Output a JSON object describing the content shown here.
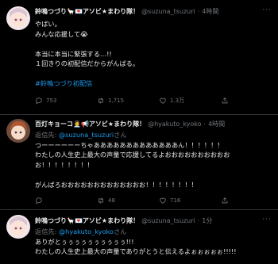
{
  "colors": {
    "background": "#000000",
    "text": "#e7e9ea",
    "muted": "#71767b",
    "link": "#1d9bf0",
    "divider": "#2f3336"
  },
  "tweets": [
    {
      "name": "鈴鳴つづり🦙💌アソビ★まわり隊！",
      "handle": "@suzuna_tsuzuri",
      "dot": "·",
      "time": "4時間",
      "lines": [
        "やばい。",
        "みんな応援して😭",
        "",
        "本当に本当に緊張する…!!",
        "１回きりの初配信だからがんばる。",
        ""
      ],
      "hashtag": "#鈴鳴つづり初配信",
      "stats": {
        "replies": "753",
        "retweets": "1,715",
        "likes": "1.3万"
      }
    },
    {
      "name": "百灯キョーコ👩‍💼📢アソビ★まわり隊！",
      "handle": "@hyakuto_kyoko",
      "dot": "·",
      "time": "4時間",
      "reply_prefix": "返信先: ",
      "reply_mention": "@suzuna_tsuzuri",
      "reply_suffix": "さん",
      "lines": [
        "つーーーーーーちゃあああああああああああああん！！！！！！",
        "わたしの人生史上最大の声量で応援してるよおおおおおおおおおお",
        "お！！！！！！！！",
        "",
        "がんばろおおおおおおおおおおおおお！！！！！！！！"
      ],
      "stats": {
        "replies": "",
        "retweets": "48",
        "likes": "716"
      }
    },
    {
      "name": "鈴鳴つづり🦙💌アソビ★まわり隊！",
      "handle": "@suzuna_tsuzuri",
      "dot": "·",
      "time": "1分",
      "reply_prefix": "返信先: ",
      "reply_mention": "@hyakuto_kyoko",
      "reply_suffix": "さん",
      "lines": [
        "ありがとぅぅぅぅぅぅぅぅぅぅ!!!",
        "わたしの人生史上最大の声量でありがとうと伝えるよぉぉぉぉぉ!!!!!"
      ]
    }
  ],
  "more_label": "···",
  "icons": [
    "reply-icon",
    "retweet-icon",
    "like-icon",
    "share-icon"
  ]
}
